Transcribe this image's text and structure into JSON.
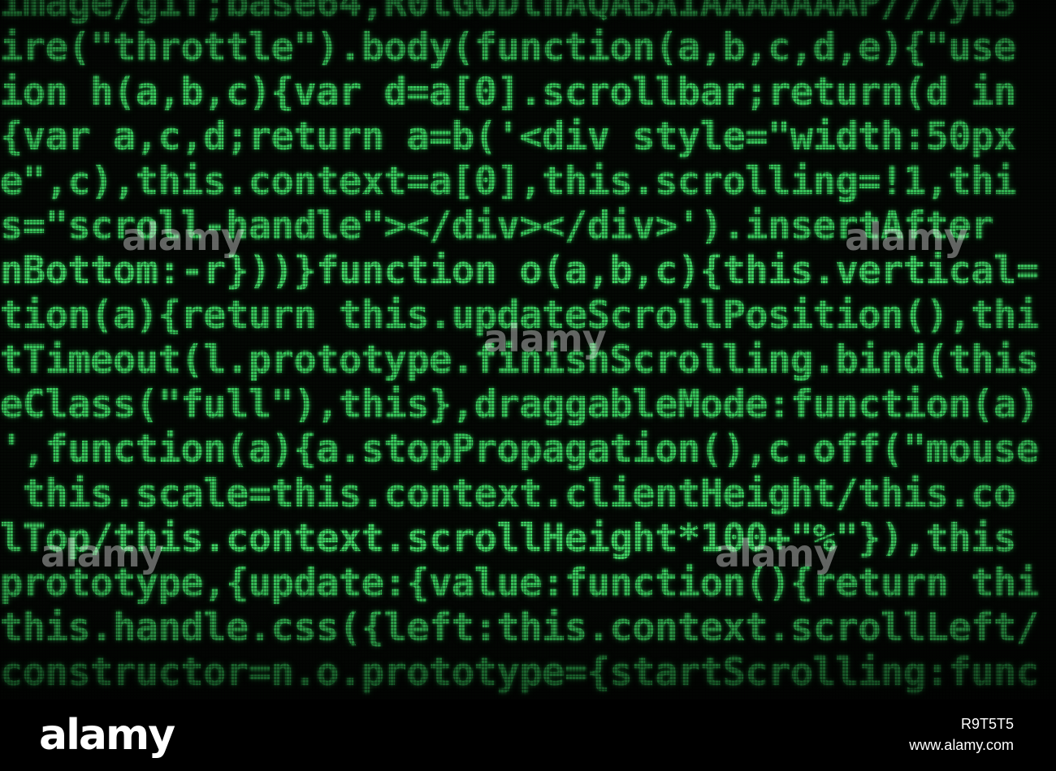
{
  "code_lines": [
    "image/gif;base64,R0lGODlhAQABAIAAAAAAAP///yH5",
    "ire(\"throttle\").body(function(a,b,c,d,e){\"use",
    "ion h(a,b,c){var d=a[0].scrollbar;return(d in",
    "{var a,c,d;return a=b('<div style=\"width:50px",
    "e\",c),this.context=a[0],this.scrolling=!1,thi",
    "s=\"scroll-handle\"></div></div>').insertAfter",
    "nBottom:-r}))}function o(a,b,c){this.vertical=",
    "tion(a){return this.updateScrollPosition(),thi",
    "tTimeout(l.prototype.finishScrolling.bind(this",
    "eClass(\"full\"),this},draggableMode:function(a)",
    "',function(a){a.stopPropagation(),c.off(\"mouse",
    " this.scale=this.context.clientHeight/this.co",
    "lTop/this.context.scrollHeight*100+\"%\"}),this",
    "prototype,{update:{value:function(){return thi",
    "this.handle.css({left:this.context.scrollLeft/",
    "constructor=n.o.prototype={startScrolling:func"
  ],
  "watermark_text": "alamy",
  "footer": {
    "logo": "alamy",
    "image_id": "R9T5T5",
    "url": "www.alamy.com"
  },
  "colors": {
    "code_text": "#37c45a",
    "background": "#040804",
    "footer_bg": "#000000",
    "footer_text": "#ffffff"
  }
}
